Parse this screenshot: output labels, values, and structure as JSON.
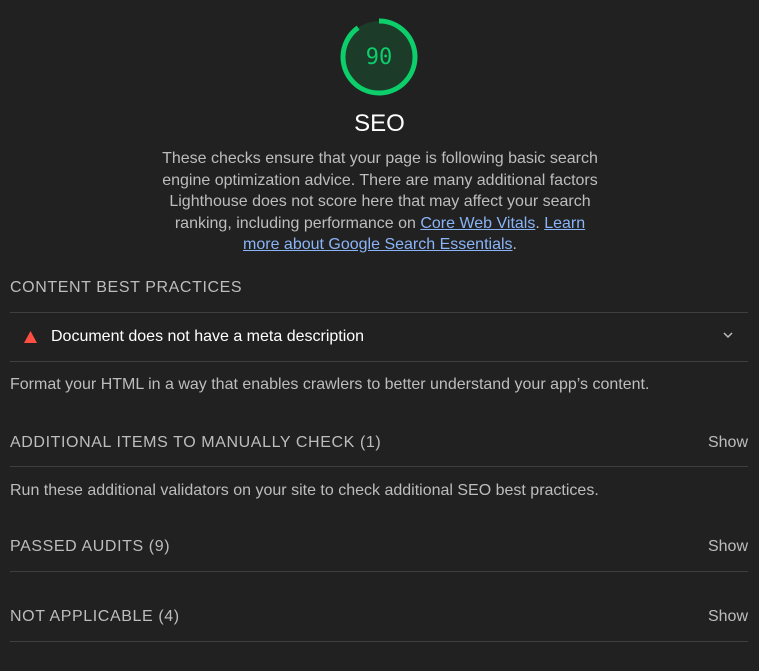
{
  "category": {
    "score": "90",
    "score_fraction": 0.9,
    "title": "SEO",
    "description_text": "These checks ensure that your page is following basic search engine optimization advice. There are many additional factors Lighthouse does not score here that may affect your search ranking, including performance on ",
    "link_core_web_vitals": "Core Web Vitals",
    "separator": ". ",
    "link_learn_more": "Learn more about Google Search Essentials",
    "end_period": "."
  },
  "groups": {
    "content": {
      "title": "CONTENT BEST PRACTICES",
      "audit_title": "Document does not have a meta description",
      "description": "Format your HTML in a way that enables crawlers to better understand your app’s content."
    },
    "manual": {
      "title": "ADDITIONAL ITEMS TO MANUALLY CHECK (1)",
      "show_label": "Show",
      "description": "Run these additional validators on your site to check additional SEO best practices."
    },
    "passed": {
      "title": "PASSED AUDITS (9)",
      "show_label": "Show"
    },
    "not_applicable": {
      "title": "NOT APPLICABLE (4)",
      "show_label": "Show"
    }
  },
  "colors": {
    "pass": "#0cce6b",
    "fail": "#ff4e42",
    "link": "#8ab4f8",
    "background": "#212121"
  },
  "icons": {
    "fail": "triangle-icon",
    "expand": "chevron-down-icon"
  }
}
